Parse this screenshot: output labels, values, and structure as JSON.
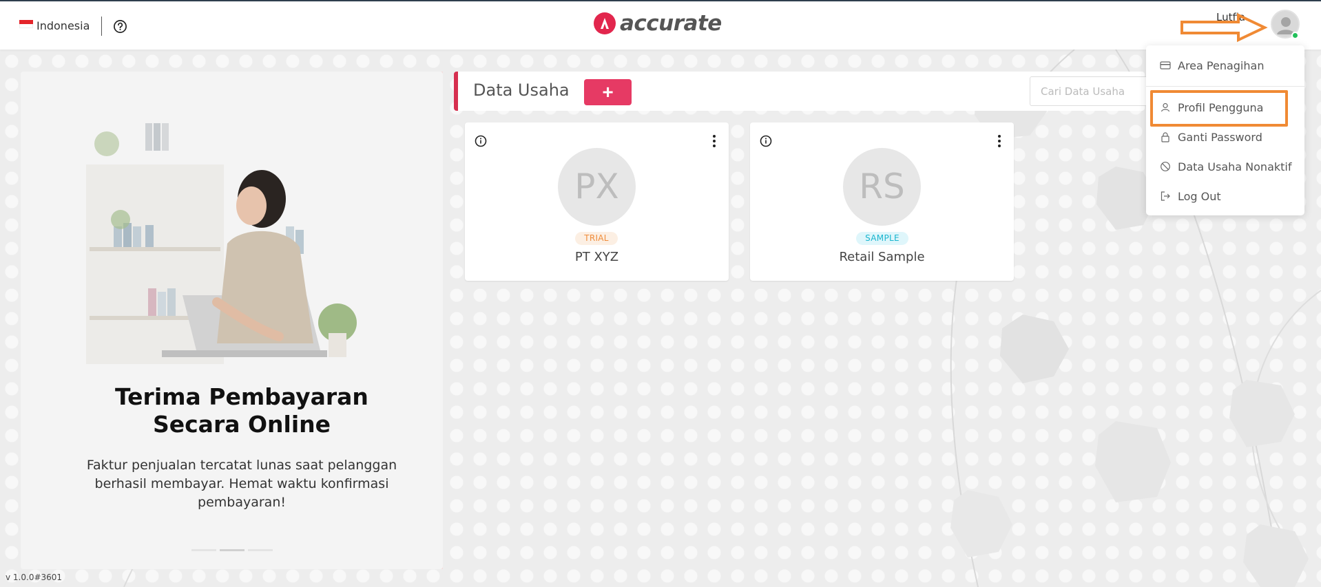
{
  "header": {
    "language": "Indonesia",
    "logo_text": "accurate",
    "user_name": "Lutfia"
  },
  "promo": {
    "title_line1": "Terima Pembayaran",
    "title_line2": "Secara Online",
    "description_line1": "Faktur penjualan tercatat lunas saat pelanggan",
    "description_line2": "berhasil membayar. Hemat waktu konfirmasi",
    "description_line3": "pembayaran!"
  },
  "data_usaha": {
    "title": "Data Usaha",
    "add_label": "+",
    "search_placeholder": "Cari Data Usaha",
    "cards": [
      {
        "initials": "PX",
        "badge": "TRIAL",
        "name": "PT XYZ"
      },
      {
        "initials": "RS",
        "badge": "SAMPLE",
        "name": "Retail Sample"
      }
    ]
  },
  "user_menu": {
    "items": [
      {
        "label": "Area Penagihan",
        "icon": "credit-card-icon"
      },
      {
        "label": "Profil Pengguna",
        "icon": "user-icon"
      },
      {
        "label": "Ganti Password",
        "icon": "lock-icon"
      },
      {
        "label": "Data Usaha Nonaktif",
        "icon": "ban-icon"
      },
      {
        "label": "Log Out",
        "icon": "logout-icon"
      }
    ]
  },
  "footer": {
    "version": "v 1.0.0#3601"
  },
  "colors": {
    "brand": "#e63a64",
    "accent_border": "#d62f4f",
    "annotation": "#f08a34",
    "online": "#22c05a"
  }
}
